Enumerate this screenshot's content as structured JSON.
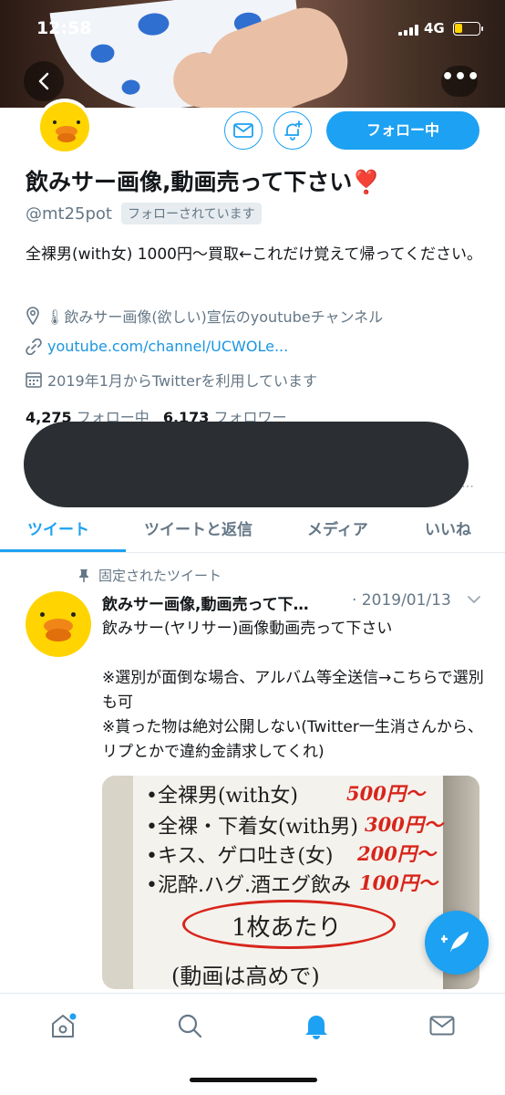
{
  "status_bar": {
    "time": "12:58",
    "network": "4G"
  },
  "profile": {
    "name": "飲みサー画像,動画売って下さい❣️",
    "handle": "@mt25pot",
    "follows_you": "フォローされています",
    "follow_button": "フォロー中",
    "bio": "全裸男(with女) 1000円〜買取←これだけ覚えて帰ってください。",
    "location": "🌡飲みサー画像(欲しい)宣伝のyoutubeチャンネル",
    "website": "youtube.com/channel/UCWOLe...",
    "joined": "2019年1月からTwitterを利用しています",
    "following_count": "4,275",
    "following_label": "フォロー中",
    "followers_count": "6,173",
    "followers_label": "フォロワー"
  },
  "tabs": [
    {
      "label": "ツイート"
    },
    {
      "label": "ツイートと返信"
    },
    {
      "label": "メディア"
    },
    {
      "label": "いいね"
    }
  ],
  "active_tab": "ツイート",
  "tweet": {
    "pinned_label": "固定されたツイート",
    "author": "飲みサー画像,動画売って下…",
    "date": "· 2019/01/13",
    "text": "飲みサー(ヤリサー)画像動画売って下さい\n\n※選別が面倒な場合、アルバム等全送信→こちらで選別も可\n※貰った物は絶対公開しない(Twitter一生消さんから、リプとかで違約金請求してくれ)",
    "image_board": {
      "line1": "•全裸男(with女)",
      "price1": "500円〜",
      "line2": "•全裸・下着女(with男)",
      "price2": "300円〜",
      "line3": "•キス、ゲロ吐き(女)",
      "price3": "200円〜",
      "line4": "•泥酔.ハグ.酒エグ飲み",
      "price4": "100円〜",
      "circled": "1枚あたり",
      "note": "(動画は高めで)"
    }
  },
  "colors": {
    "accent": "#1da1f2",
    "text": "#14171a",
    "muted": "#657786",
    "avatar": "#ffd400"
  },
  "icons": [
    "back-icon",
    "more-icon",
    "mail-icon",
    "bell-plus-icon",
    "location-icon",
    "link-icon",
    "calendar-icon",
    "pin-icon",
    "chevron-down-icon",
    "compose-icon",
    "home-icon",
    "search-icon",
    "notifications-icon",
    "messages-icon"
  ]
}
